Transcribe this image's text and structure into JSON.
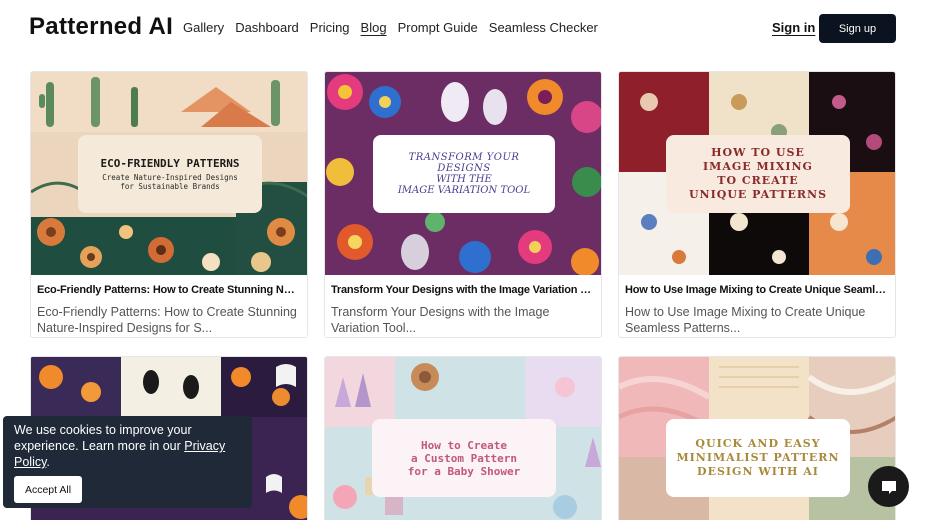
{
  "header": {
    "logo": "Patterned AI",
    "nav": [
      {
        "label": "Gallery",
        "name": "nav-gallery"
      },
      {
        "label": "Dashboard",
        "name": "nav-dashboard"
      },
      {
        "label": "Pricing",
        "name": "nav-pricing"
      },
      {
        "label": "Blog",
        "name": "nav-blog",
        "active": true
      },
      {
        "label": "Prompt Guide",
        "name": "nav-prompt-guide"
      },
      {
        "label": "Seamless Checker",
        "name": "nav-seamless-checker"
      }
    ],
    "sign_in": "Sign in",
    "sign_up": "Sign up"
  },
  "cards": [
    {
      "overlay_lines": [
        "ECO-FRIENDLY PATTERNS",
        "Create Nature-Inspired Designs",
        "for Sustainable Brands"
      ],
      "title": "Eco-Friendly Patterns: How to Create Stunning Nature-Inspired Designs for Sustainable Brands",
      "excerpt": "Eco-Friendly Patterns: How to Create Stunning Nature-Inspired Designs for S..."
    },
    {
      "overlay_lines": [
        "TRANSFORM YOUR DESIGNS",
        "WITH THE",
        "IMAGE VARIATION TOOL"
      ],
      "title": "Transform Your Designs with the Image Variation Tool",
      "excerpt": "Transform Your Designs with the Image Variation Tool..."
    },
    {
      "overlay_lines": [
        "HOW TO USE",
        "IMAGE MIXING",
        "TO CREATE",
        "UNIQUE PATTERNS"
      ],
      "title": "How to Use Image Mixing to Create Unique Seamless Patterns",
      "excerpt": "How to Use Image Mixing to Create Unique Seamless Patterns..."
    },
    {
      "overlay_lines": [],
      "title": "",
      "excerpt": ""
    },
    {
      "overlay_lines": [
        "How to Create",
        "a Custom Pattern",
        "for a Baby Shower"
      ],
      "title": "",
      "excerpt": ""
    },
    {
      "overlay_lines": [
        "QUICK AND EASY",
        "MINIMALIST PATTERN",
        "DESIGN WITH AI"
      ],
      "title": "",
      "excerpt": ""
    }
  ],
  "cookie": {
    "text": "We use cookies to improve your experience. Learn more in our ",
    "privacy_link": "Privacy Policy",
    "suffix": ".",
    "accept": "Accept All"
  },
  "colors": {
    "signup_bg": "#0b1220",
    "cookie_bg": "#1f2937",
    "overlay_bg": "#f7efe3"
  }
}
